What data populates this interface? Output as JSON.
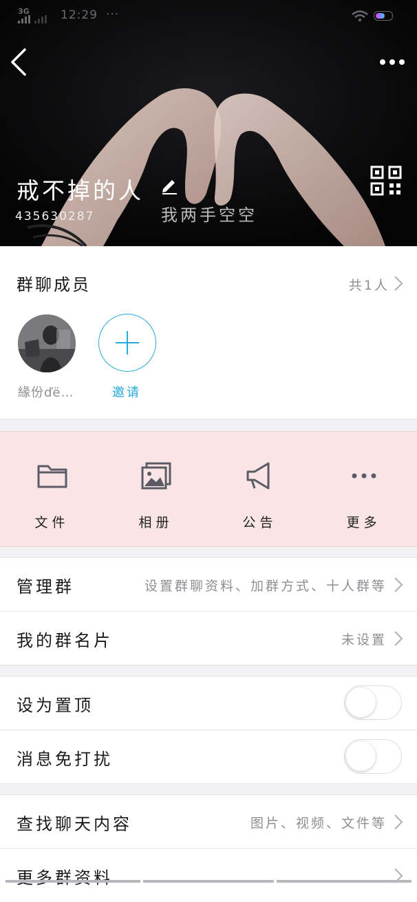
{
  "status_bar": {
    "network": "3G",
    "time": "12:29",
    "dots": "···"
  },
  "header": {
    "group_name": "戒不掉的人",
    "group_id": "435630287",
    "photo_text_line1": "我两手空空"
  },
  "members": {
    "title": "群聊成员",
    "count": "共1人",
    "member_name": "緣份ďë…",
    "invite_label": "邀请"
  },
  "functions": [
    {
      "label": "文件",
      "icon": "folder-icon"
    },
    {
      "label": "相册",
      "icon": "album-icon"
    },
    {
      "label": "公告",
      "icon": "megaphone-icon"
    },
    {
      "label": "更多",
      "icon": "more-dots-icon"
    }
  ],
  "manage": {
    "manage_group": {
      "title": "管理群",
      "value": "设置群聊资料、加群方式、十人群等"
    },
    "my_card": {
      "title": "我的群名片",
      "value": "未设置"
    }
  },
  "settings": {
    "pin": {
      "title": "设为置顶",
      "on": false
    },
    "mute": {
      "title": "消息免打扰",
      "on": false
    }
  },
  "search": {
    "find_chat": {
      "title": "查找聊天内容",
      "value": "图片、视频、文件等"
    },
    "more_info": {
      "title": "更多群资料"
    }
  },
  "colors": {
    "accent": "#26a8dd",
    "pink_panel": "#fbe4e6",
    "background": "#f2f2f4"
  }
}
